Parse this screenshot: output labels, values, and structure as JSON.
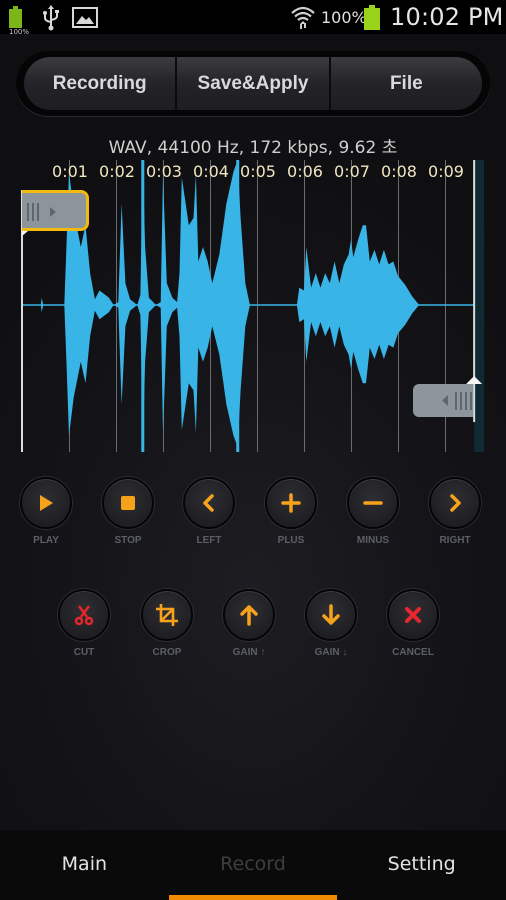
{
  "status_bar": {
    "left_battery_percent": "100%",
    "notification_icons": [
      "battery-icon",
      "usb-icon",
      "image-icon"
    ],
    "wifi": "wifi-icon",
    "battery_percent": "100%",
    "time": "10:02 PM",
    "battery_color": "#9bd21a"
  },
  "segmented_control": {
    "buttons": [
      {
        "label": "Recording"
      },
      {
        "label": "Save&Apply"
      },
      {
        "label": "File"
      }
    ]
  },
  "file_info": "WAV, 44100 Hz, 172 kbps, 9.62 초",
  "timeline": {
    "duration_seconds": 9.62,
    "ticks": [
      "0:01",
      "0:02",
      "0:03",
      "0:04",
      "0:05",
      "0:06",
      "0:07",
      "0:08",
      "0:09"
    ],
    "selection_start_seconds": 0.0,
    "selection_end_seconds": 9.62,
    "markers_seconds": [
      2.57,
      4.59
    ],
    "waveform_color": "#38b4e6",
    "handle_accent": "#f2b90f"
  },
  "waveform_envelope": [
    [
      0.0,
      0.0
    ],
    [
      0.4,
      0.0
    ],
    [
      0.42,
      0.05
    ],
    [
      0.45,
      0.0
    ],
    [
      0.9,
      0.0
    ],
    [
      0.95,
      0.45
    ],
    [
      1.0,
      0.92
    ],
    [
      1.1,
      0.65
    ],
    [
      1.25,
      0.4
    ],
    [
      1.35,
      0.55
    ],
    [
      1.45,
      0.22
    ],
    [
      1.55,
      0.04
    ],
    [
      1.65,
      0.1
    ],
    [
      1.85,
      0.05
    ],
    [
      1.95,
      0.0
    ],
    [
      2.05,
      0.02
    ],
    [
      2.12,
      0.7
    ],
    [
      2.2,
      0.15
    ],
    [
      2.3,
      0.04
    ],
    [
      2.45,
      0.0
    ],
    [
      2.52,
      0.07
    ],
    [
      2.57,
      1.0
    ],
    [
      2.62,
      0.4
    ],
    [
      2.7,
      0.05
    ],
    [
      2.85,
      0.0
    ],
    [
      2.95,
      0.02
    ],
    [
      3.0,
      0.9
    ],
    [
      3.08,
      0.15
    ],
    [
      3.2,
      0.05
    ],
    [
      3.3,
      0.02
    ],
    [
      3.35,
      0.22
    ],
    [
      3.4,
      0.88
    ],
    [
      3.55,
      0.55
    ],
    [
      3.65,
      0.6
    ],
    [
      3.7,
      0.9
    ],
    [
      3.75,
      0.3
    ],
    [
      3.85,
      0.4
    ],
    [
      3.95,
      0.3
    ],
    [
      4.05,
      0.15
    ],
    [
      4.2,
      0.35
    ],
    [
      4.35,
      0.7
    ],
    [
      4.5,
      0.92
    ],
    [
      4.59,
      1.0
    ],
    [
      4.65,
      0.6
    ],
    [
      4.75,
      0.15
    ],
    [
      4.85,
      0.0
    ],
    [
      5.85,
      0.0
    ],
    [
      5.9,
      0.12
    ],
    [
      6.0,
      0.1
    ],
    [
      6.05,
      0.4
    ],
    [
      6.15,
      0.12
    ],
    [
      6.25,
      0.22
    ],
    [
      6.35,
      0.12
    ],
    [
      6.45,
      0.22
    ],
    [
      6.55,
      0.15
    ],
    [
      6.65,
      0.3
    ],
    [
      6.75,
      0.15
    ],
    [
      6.85,
      0.28
    ],
    [
      6.95,
      0.35
    ],
    [
      7.0,
      0.45
    ],
    [
      7.05,
      0.33
    ],
    [
      7.15,
      0.45
    ],
    [
      7.25,
      0.55
    ],
    [
      7.32,
      0.55
    ],
    [
      7.4,
      0.3
    ],
    [
      7.5,
      0.38
    ],
    [
      7.6,
      0.28
    ],
    [
      7.7,
      0.38
    ],
    [
      7.8,
      0.28
    ],
    [
      7.9,
      0.3
    ],
    [
      8.0,
      0.2
    ],
    [
      8.15,
      0.14
    ],
    [
      8.3,
      0.06
    ],
    [
      8.45,
      0.0
    ],
    [
      9.62,
      0.0
    ]
  ],
  "controls_row1": [
    {
      "id": "play",
      "label": "PLAY",
      "icon": "play-icon"
    },
    {
      "id": "stop",
      "label": "STOP",
      "icon": "stop-icon"
    },
    {
      "id": "left",
      "label": "LEFT",
      "icon": "chevron-left-icon"
    },
    {
      "id": "plus",
      "label": "PLUS",
      "icon": "plus-icon"
    },
    {
      "id": "minus",
      "label": "MINUS",
      "icon": "minus-icon"
    },
    {
      "id": "right",
      "label": "RIGHT",
      "icon": "chevron-right-icon"
    }
  ],
  "controls_row2": [
    {
      "id": "cut",
      "label": "CUT",
      "icon": "scissors-icon"
    },
    {
      "id": "crop",
      "label": "CROP",
      "icon": "crop-icon"
    },
    {
      "id": "gain-up",
      "label": "GAIN ↑",
      "icon": "arrow-up-icon"
    },
    {
      "id": "gain-down",
      "label": "GAIN ↓",
      "icon": "arrow-down-icon"
    },
    {
      "id": "cancel",
      "label": "CANCEL",
      "icon": "close-icon"
    }
  ],
  "colors": {
    "icon_orange": "#f7a21b",
    "icon_red": "#e8262c",
    "tab_indicator": "#f08a00"
  },
  "bottom_nav": {
    "tabs": [
      {
        "label": "Main",
        "active": false
      },
      {
        "label": "Record",
        "active": true
      },
      {
        "label": "Setting",
        "active": false
      }
    ]
  }
}
